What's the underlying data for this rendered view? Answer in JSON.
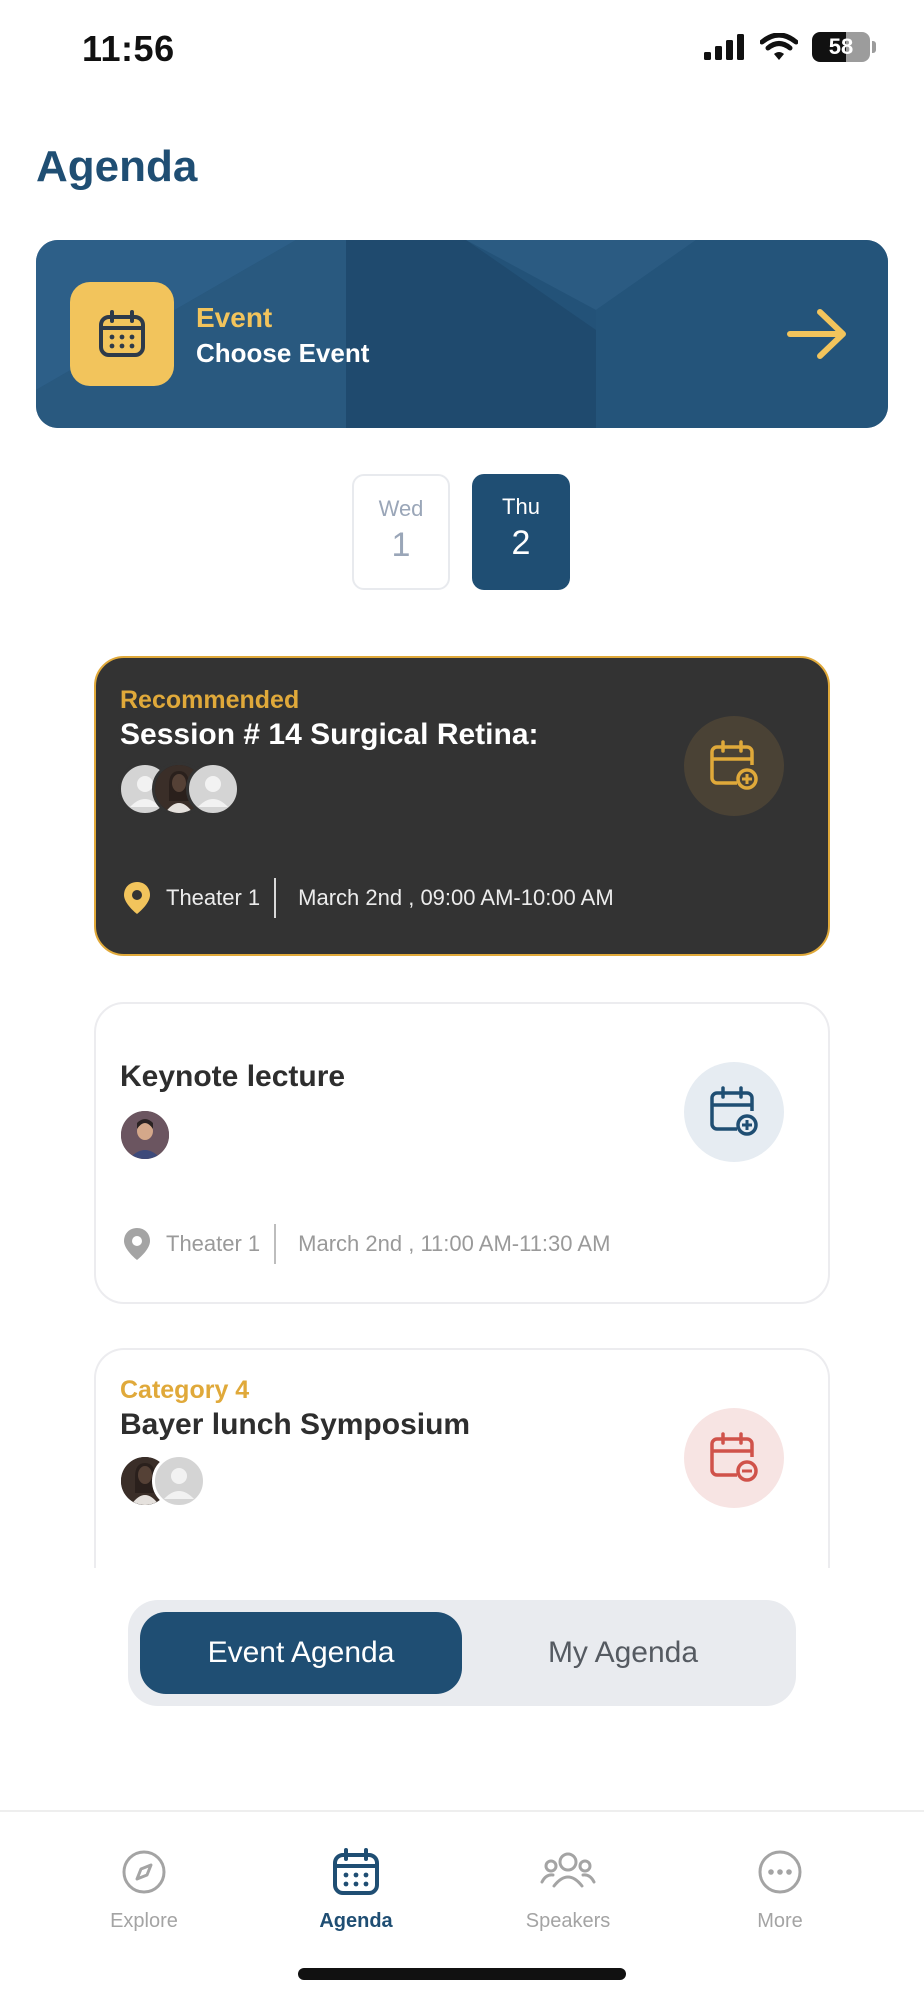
{
  "status_bar": {
    "time": "11:56",
    "battery": "58",
    "battery_level": 0.58
  },
  "page": {
    "title": "Agenda"
  },
  "event_selector": {
    "label": "Event",
    "value": "Choose Event"
  },
  "days": [
    {
      "dow": "Wed",
      "day": "1",
      "selected": false
    },
    {
      "dow": "Thu",
      "day": "2",
      "selected": true
    }
  ],
  "sessions": [
    {
      "tag": "Recommended",
      "title": "Session # 14 Surgical Retina:",
      "location": "Theater 1",
      "time": "March 2nd , 09:00 AM-10:00 AM",
      "action": "add"
    },
    {
      "tag": "",
      "title": "Keynote lecture",
      "location": "Theater 1",
      "time": "March 2nd , 11:00 AM-11:30 AM",
      "action": "add"
    },
    {
      "tag": "Category 4",
      "title": "Bayer lunch Symposium",
      "action": "remove"
    }
  ],
  "agenda_toggle": {
    "event_agenda": "Event Agenda",
    "my_agenda": "My Agenda",
    "selected": "event_agenda"
  },
  "bottom_nav": {
    "explore": "Explore",
    "agenda": "Agenda",
    "speakers": "Speakers",
    "more": "More",
    "active": "agenda"
  },
  "colors": {
    "primary": "#1f4e73",
    "accent": "#f2c45c",
    "card_dark": "#333333",
    "remove": "#d0524a"
  },
  "icons": [
    "calendar-icon",
    "arrow-right-icon",
    "calendar-add-icon",
    "calendar-remove-icon",
    "location-pin-icon",
    "compass-icon",
    "speakers-icon",
    "more-icon",
    "avatar-placeholder-icon"
  ]
}
